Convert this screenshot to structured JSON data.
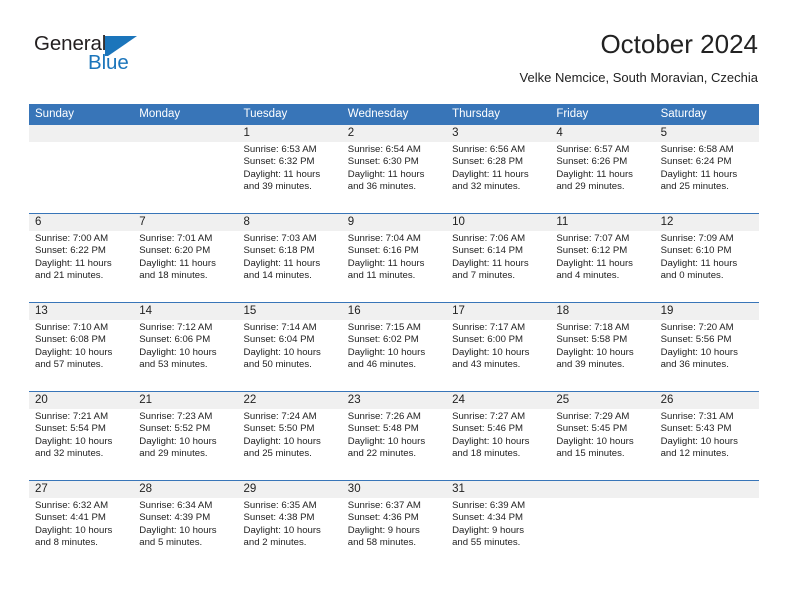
{
  "brand": {
    "name_part1": "General",
    "name_part2": "Blue",
    "accent_color": "#1b75bb",
    "flag_icon": "triangle-flag-icon"
  },
  "header": {
    "title": "October 2024",
    "location": "Velke Nemcice, South Moravian, Czechia"
  },
  "calendar": {
    "header_color": "#3875b8",
    "number_band_color": "#f0f0f0",
    "day_names": [
      "Sunday",
      "Monday",
      "Tuesday",
      "Wednesday",
      "Thursday",
      "Friday",
      "Saturday"
    ],
    "weeks": [
      [
        {
          "day": "",
          "lines": []
        },
        {
          "day": "",
          "lines": []
        },
        {
          "day": "1",
          "lines": [
            "Sunrise: 6:53 AM",
            "Sunset: 6:32 PM",
            "Daylight: 11 hours",
            "and 39 minutes."
          ]
        },
        {
          "day": "2",
          "lines": [
            "Sunrise: 6:54 AM",
            "Sunset: 6:30 PM",
            "Daylight: 11 hours",
            "and 36 minutes."
          ]
        },
        {
          "day": "3",
          "lines": [
            "Sunrise: 6:56 AM",
            "Sunset: 6:28 PM",
            "Daylight: 11 hours",
            "and 32 minutes."
          ]
        },
        {
          "day": "4",
          "lines": [
            "Sunrise: 6:57 AM",
            "Sunset: 6:26 PM",
            "Daylight: 11 hours",
            "and 29 minutes."
          ]
        },
        {
          "day": "5",
          "lines": [
            "Sunrise: 6:58 AM",
            "Sunset: 6:24 PM",
            "Daylight: 11 hours",
            "and 25 minutes."
          ]
        }
      ],
      [
        {
          "day": "6",
          "lines": [
            "Sunrise: 7:00 AM",
            "Sunset: 6:22 PM",
            "Daylight: 11 hours",
            "and 21 minutes."
          ]
        },
        {
          "day": "7",
          "lines": [
            "Sunrise: 7:01 AM",
            "Sunset: 6:20 PM",
            "Daylight: 11 hours",
            "and 18 minutes."
          ]
        },
        {
          "day": "8",
          "lines": [
            "Sunrise: 7:03 AM",
            "Sunset: 6:18 PM",
            "Daylight: 11 hours",
            "and 14 minutes."
          ]
        },
        {
          "day": "9",
          "lines": [
            "Sunrise: 7:04 AM",
            "Sunset: 6:16 PM",
            "Daylight: 11 hours",
            "and 11 minutes."
          ]
        },
        {
          "day": "10",
          "lines": [
            "Sunrise: 7:06 AM",
            "Sunset: 6:14 PM",
            "Daylight: 11 hours",
            "and 7 minutes."
          ]
        },
        {
          "day": "11",
          "lines": [
            "Sunrise: 7:07 AM",
            "Sunset: 6:12 PM",
            "Daylight: 11 hours",
            "and 4 minutes."
          ]
        },
        {
          "day": "12",
          "lines": [
            "Sunrise: 7:09 AM",
            "Sunset: 6:10 PM",
            "Daylight: 11 hours",
            "and 0 minutes."
          ]
        }
      ],
      [
        {
          "day": "13",
          "lines": [
            "Sunrise: 7:10 AM",
            "Sunset: 6:08 PM",
            "Daylight: 10 hours",
            "and 57 minutes."
          ]
        },
        {
          "day": "14",
          "lines": [
            "Sunrise: 7:12 AM",
            "Sunset: 6:06 PM",
            "Daylight: 10 hours",
            "and 53 minutes."
          ]
        },
        {
          "day": "15",
          "lines": [
            "Sunrise: 7:14 AM",
            "Sunset: 6:04 PM",
            "Daylight: 10 hours",
            "and 50 minutes."
          ]
        },
        {
          "day": "16",
          "lines": [
            "Sunrise: 7:15 AM",
            "Sunset: 6:02 PM",
            "Daylight: 10 hours",
            "and 46 minutes."
          ]
        },
        {
          "day": "17",
          "lines": [
            "Sunrise: 7:17 AM",
            "Sunset: 6:00 PM",
            "Daylight: 10 hours",
            "and 43 minutes."
          ]
        },
        {
          "day": "18",
          "lines": [
            "Sunrise: 7:18 AM",
            "Sunset: 5:58 PM",
            "Daylight: 10 hours",
            "and 39 minutes."
          ]
        },
        {
          "day": "19",
          "lines": [
            "Sunrise: 7:20 AM",
            "Sunset: 5:56 PM",
            "Daylight: 10 hours",
            "and 36 minutes."
          ]
        }
      ],
      [
        {
          "day": "20",
          "lines": [
            "Sunrise: 7:21 AM",
            "Sunset: 5:54 PM",
            "Daylight: 10 hours",
            "and 32 minutes."
          ]
        },
        {
          "day": "21",
          "lines": [
            "Sunrise: 7:23 AM",
            "Sunset: 5:52 PM",
            "Daylight: 10 hours",
            "and 29 minutes."
          ]
        },
        {
          "day": "22",
          "lines": [
            "Sunrise: 7:24 AM",
            "Sunset: 5:50 PM",
            "Daylight: 10 hours",
            "and 25 minutes."
          ]
        },
        {
          "day": "23",
          "lines": [
            "Sunrise: 7:26 AM",
            "Sunset: 5:48 PM",
            "Daylight: 10 hours",
            "and 22 minutes."
          ]
        },
        {
          "day": "24",
          "lines": [
            "Sunrise: 7:27 AM",
            "Sunset: 5:46 PM",
            "Daylight: 10 hours",
            "and 18 minutes."
          ]
        },
        {
          "day": "25",
          "lines": [
            "Sunrise: 7:29 AM",
            "Sunset: 5:45 PM",
            "Daylight: 10 hours",
            "and 15 minutes."
          ]
        },
        {
          "day": "26",
          "lines": [
            "Sunrise: 7:31 AM",
            "Sunset: 5:43 PM",
            "Daylight: 10 hours",
            "and 12 minutes."
          ]
        }
      ],
      [
        {
          "day": "27",
          "lines": [
            "Sunrise: 6:32 AM",
            "Sunset: 4:41 PM",
            "Daylight: 10 hours",
            "and 8 minutes."
          ]
        },
        {
          "day": "28",
          "lines": [
            "Sunrise: 6:34 AM",
            "Sunset: 4:39 PM",
            "Daylight: 10 hours",
            "and 5 minutes."
          ]
        },
        {
          "day": "29",
          "lines": [
            "Sunrise: 6:35 AM",
            "Sunset: 4:38 PM",
            "Daylight: 10 hours",
            "and 2 minutes."
          ]
        },
        {
          "day": "30",
          "lines": [
            "Sunrise: 6:37 AM",
            "Sunset: 4:36 PM",
            "Daylight: 9 hours",
            "and 58 minutes."
          ]
        },
        {
          "day": "31",
          "lines": [
            "Sunrise: 6:39 AM",
            "Sunset: 4:34 PM",
            "Daylight: 9 hours",
            "and 55 minutes."
          ]
        },
        {
          "day": "",
          "lines": []
        },
        {
          "day": "",
          "lines": []
        }
      ]
    ]
  }
}
